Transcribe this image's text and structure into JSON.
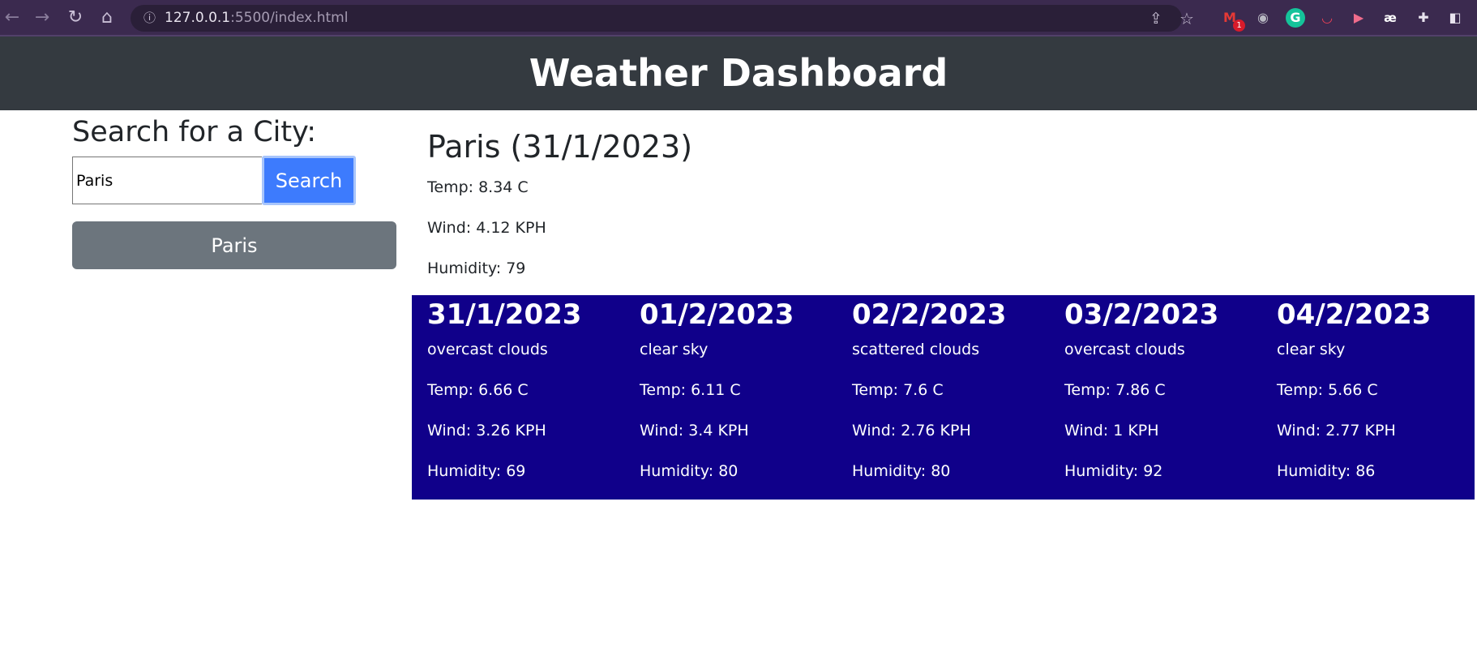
{
  "browser": {
    "url_host": "127.0.0.1",
    "url_rest": ":5500/index.html",
    "gmail_badge": "1"
  },
  "header": {
    "title": "Weather Dashboard"
  },
  "search": {
    "heading": "Search for a City:",
    "input_value": "Paris",
    "button_label": "Search"
  },
  "history": [
    {
      "label": "Paris"
    }
  ],
  "current": {
    "title": "Paris (31/1/2023)",
    "temp": "Temp: 8.34 C",
    "wind": "Wind: 4.12 KPH",
    "humidity": "Humidity: 79"
  },
  "forecast": [
    {
      "date": "31/1/2023",
      "desc": "overcast clouds",
      "temp": "Temp: 6.66 C",
      "wind": "Wind: 3.26 KPH",
      "humidity": "Humidity: 69"
    },
    {
      "date": "01/2/2023",
      "desc": "clear sky",
      "temp": "Temp: 6.11 C",
      "wind": "Wind: 3.4 KPH",
      "humidity": "Humidity: 80"
    },
    {
      "date": "02/2/2023",
      "desc": "scattered clouds",
      "temp": "Temp: 7.6 C",
      "wind": "Wind: 2.76 KPH",
      "humidity": "Humidity: 80"
    },
    {
      "date": "03/2/2023",
      "desc": "overcast clouds",
      "temp": "Temp: 7.86 C",
      "wind": "Wind: 1 KPH",
      "humidity": "Humidity: 92"
    },
    {
      "date": "04/2/2023",
      "desc": "clear sky",
      "temp": "Temp: 5.66 C",
      "wind": "Wind: 2.77 KPH",
      "humidity": "Humidity: 86"
    }
  ],
  "colors": {
    "header_bg": "#343a40",
    "search_button": "#3d7bfd",
    "history_button": "#6c757d",
    "forecast_bg": "#10008a"
  }
}
